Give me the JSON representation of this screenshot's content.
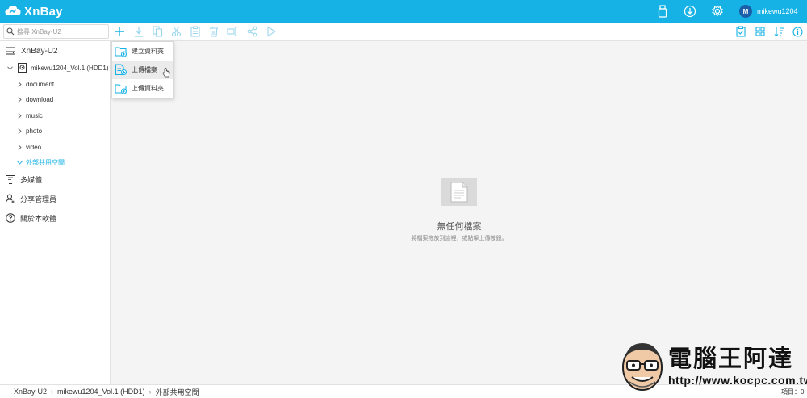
{
  "header": {
    "brand": "XnBay",
    "username": "mikewu1204",
    "avatar_letter": "M",
    "icons": [
      "usb-drive-icon",
      "download-icon",
      "settings-gear-icon"
    ],
    "color": "#16b2e6"
  },
  "toolbar": {
    "search_placeholder": "搜尋 XnBay-U2",
    "tools": [
      "add-icon",
      "download-icon",
      "copy-icon",
      "cut-icon",
      "paste-icon",
      "delete-icon",
      "rename-icon",
      "share-icon",
      "play-icon"
    ],
    "right_tools": [
      "clipboard-icon",
      "grid-view-icon",
      "sort-icon",
      "info-icon"
    ]
  },
  "sidebar": {
    "device": "XnBay-U2",
    "volume": "mikewu1204_Vol.1 (HDD1)",
    "folders": [
      "document",
      "download",
      "music",
      "photo",
      "video"
    ],
    "active_folder": "外部共用空間",
    "sections": [
      "多媒體",
      "分享管理員",
      "關於本軟體"
    ]
  },
  "dropdown": {
    "items": [
      "建立資料夾",
      "上傳檔案",
      "上傳資料夾"
    ]
  },
  "empty": {
    "title": "無任何檔案",
    "subtitle": "將檔案拖放到這裡，或點擊上傳按鈕。"
  },
  "status": {
    "crumbs": [
      "XnBay-U2",
      "mikewu1204_Vol.1 (HDD1)",
      "外部共用空間"
    ],
    "count": "項目：0"
  },
  "watermark": {
    "text": "電腦王阿達",
    "url": "http://www.kocpc.com.tw"
  }
}
